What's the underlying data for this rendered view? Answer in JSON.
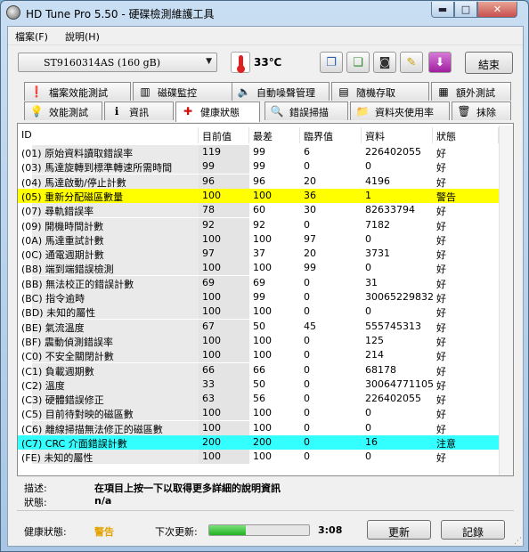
{
  "window": {
    "title": "HD Tune Pro 5.50 - 硬碟檢測維護工具",
    "minimize_glyph": "▬",
    "maximize_glyph": "□",
    "close_glyph": "✕"
  },
  "menu": {
    "file": "檔案(F)",
    "help": "說明(H)"
  },
  "toolbar": {
    "drive": "ST9160314AS (160 gB)",
    "temperature": "33℃",
    "exit_label": "結束",
    "icons": [
      "copy-text-icon",
      "copy-info-icon",
      "screenshot-camera-icon",
      "options-icon",
      "download-icon"
    ]
  },
  "tabs": {
    "row1": [
      "檔案效能測試",
      "磁碟監控",
      "自動噪聲管理",
      "隨機存取",
      "額外測試"
    ],
    "row2": [
      "效能測試",
      "資訊",
      "健康狀態",
      "錯誤掃描",
      "資料夾使用率",
      "抹除"
    ],
    "active": "健康狀態"
  },
  "table": {
    "headers": [
      "ID",
      "目前值",
      "最差",
      "臨界值",
      "資料",
      "狀態"
    ],
    "rows": [
      [
        "(01) 原始資料讀取錯誤率",
        "119",
        "99",
        "6",
        "226402055",
        "好"
      ],
      [
        "(03) 馬達旋轉到標準轉速所需時間",
        "99",
        "99",
        "0",
        "0",
        "好"
      ],
      [
        "(04) 馬達啟動/停止計數",
        "96",
        "96",
        "20",
        "4196",
        "好"
      ],
      [
        "(05) 重新分配磁區數量",
        "100",
        "100",
        "36",
        "1",
        "警告"
      ],
      [
        "(07) 尋軌錯誤率",
        "78",
        "60",
        "30",
        "82633794",
        "好"
      ],
      [
        "(09) 開機時間計數",
        "92",
        "92",
        "0",
        "7182",
        "好"
      ],
      [
        "(0A) 馬達重試計數",
        "100",
        "100",
        "97",
        "0",
        "好"
      ],
      [
        "(0C) 通電週期計數",
        "97",
        "37",
        "20",
        "3731",
        "好"
      ],
      [
        "(B8) 端到端錯誤檢測",
        "100",
        "100",
        "99",
        "0",
        "好"
      ],
      [
        "(BB) 無法校正的錯誤計數",
        "69",
        "69",
        "0",
        "31",
        "好"
      ],
      [
        "(BC) 指令逾時",
        "100",
        "99",
        "0",
        "30065229832",
        "好"
      ],
      [
        "(BD) 未知的屬性",
        "100",
        "100",
        "0",
        "0",
        "好"
      ],
      [
        "(BE) 氣流溫度",
        "67",
        "50",
        "45",
        "555745313",
        "好"
      ],
      [
        "(BF) 震動偵測錯誤率",
        "100",
        "100",
        "0",
        "125",
        "好"
      ],
      [
        "(C0) 不安全關閉計數",
        "100",
        "100",
        "0",
        "214",
        "好"
      ],
      [
        "(C1) 負載週期數",
        "66",
        "66",
        "0",
        "68178",
        "好"
      ],
      [
        "(C2) 溫度",
        "33",
        "50",
        "0",
        "30064771105",
        "好"
      ],
      [
        "(C3) 硬體錯誤修正",
        "63",
        "56",
        "0",
        "226402055",
        "好"
      ],
      [
        "(C5) 目前待對映的磁區數",
        "100",
        "100",
        "0",
        "0",
        "好"
      ],
      [
        "(C6) 離線掃描無法修正的磁區數",
        "100",
        "100",
        "0",
        "0",
        "好"
      ],
      [
        "(C7) CRC 介面錯誤計數",
        "200",
        "200",
        "0",
        "16",
        "注意"
      ],
      [
        "(FE) 未知的屬性",
        "100",
        "100",
        "0",
        "0",
        "好"
      ]
    ],
    "highlight": {
      "warning_row": 3,
      "warning_color": "#ffff00",
      "caution_row": 20,
      "caution_color": "#33ffff"
    }
  },
  "info": {
    "description_label": "描述:",
    "description_value": "在項目上按一下以取得更多詳細的說明資訊",
    "status_label": "狀態:",
    "status_value": "n/a"
  },
  "statusbar": {
    "health_label": "健康狀態:",
    "health_value": "警告",
    "health_color": "#e3a300",
    "next_update_label": "下次更新:",
    "next_update_progress": 0.37,
    "next_update_time": "3:08",
    "refresh_label": "更新",
    "log_label": "記錄"
  }
}
